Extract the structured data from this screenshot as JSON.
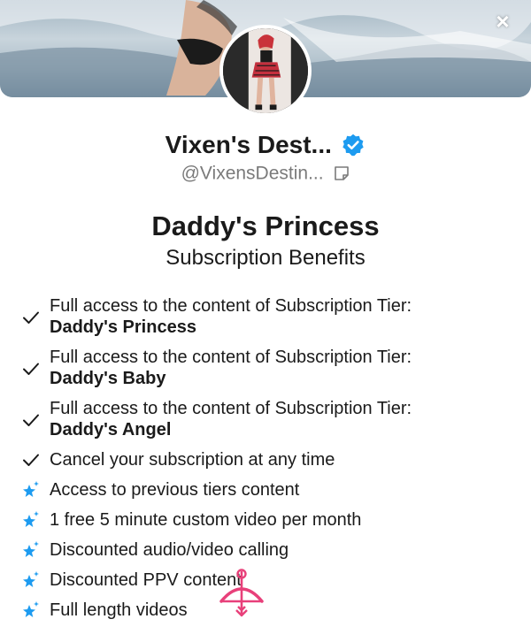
{
  "header": {
    "close_icon": "×"
  },
  "profile": {
    "name": "Vixen's Dest...",
    "handle": "@VixensDestin...",
    "verified_color": "#1d9bf0"
  },
  "tier": {
    "title": "Daddy's Princess",
    "subtitle": "Subscription Benefits"
  },
  "benefits": [
    {
      "icon": "check-icon",
      "text": "Full access to the content of Subscription Tier:",
      "detail": "Daddy's Princess"
    },
    {
      "icon": "check-icon",
      "text": "Full access to the content of Subscription Tier:",
      "detail": "Daddy's Baby"
    },
    {
      "icon": "check-icon",
      "text": "Full access to the content of Subscription Tier:",
      "detail": "Daddy's Angel"
    },
    {
      "icon": "check-icon",
      "text": "Cancel your subscription at any time"
    },
    {
      "icon": "sparkle-star-icon",
      "text": "Access to previous tiers content"
    },
    {
      "icon": "sparkle-star-icon",
      "text": "1 free 5 minute custom video per month"
    },
    {
      "icon": "sparkle-star-icon",
      "text": "Discounted audio/video calling"
    },
    {
      "icon": "sparkle-star-icon",
      "text": "Discounted PPV content"
    },
    {
      "icon": "sparkle-star-icon",
      "text": "Full length videos"
    }
  ],
  "colors": {
    "accent": "#1d9bf0",
    "cupid": "#e8407a"
  }
}
